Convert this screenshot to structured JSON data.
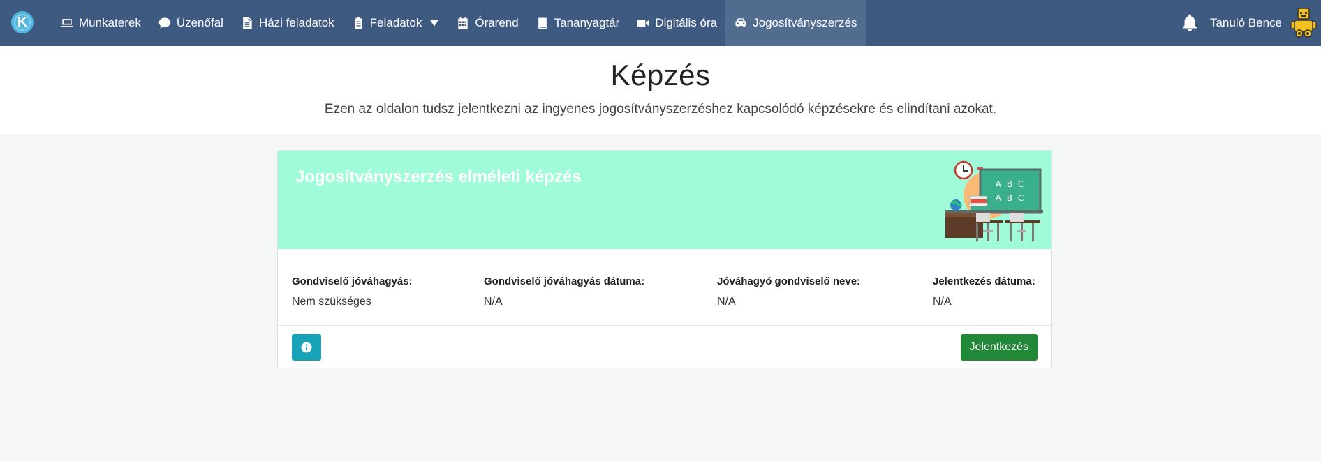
{
  "navbar": {
    "logo_letter": "K",
    "items": [
      {
        "label": "Munkaterek",
        "icon": "laptop-icon"
      },
      {
        "label": "Üzenőfal",
        "icon": "chat-bubble-icon"
      },
      {
        "label": "Házi feladatok",
        "icon": "document-icon"
      },
      {
        "label": "Feladatok",
        "icon": "clipboard-icon"
      },
      {
        "label": "Órarend",
        "icon": "calendar-icon"
      },
      {
        "label": "Tananyagtár",
        "icon": "book-icon"
      },
      {
        "label": "Digitális óra",
        "icon": "video-camera-icon"
      },
      {
        "label": "Jogosítványszerzés",
        "icon": "car-icon",
        "active": true
      }
    ],
    "user_name": "Tanuló Bence",
    "colors": {
      "background": "#3f5a80",
      "active": "#526c90"
    }
  },
  "header": {
    "title": "Képzés",
    "subtitle": "Ezen az oldalon tudsz jelentkezni az ingyenes jogosítványszerzéshez kapcsolódó képzésekre és elindítani azokat."
  },
  "card": {
    "title": "Jogosítványszerzés elméleti képzés",
    "banner_color": "#a0fcd8",
    "illustration": {
      "board_text_1": "A B C",
      "board_text_2": "A B C"
    },
    "fields": [
      {
        "label": "Gondviselő jóváhagyás:",
        "value": "Nem szükséges"
      },
      {
        "label": "Gondviselő jóváhagyás dátuma:",
        "value": "N/A"
      },
      {
        "label": "Jóváhagyó gondviselő neve:",
        "value": "N/A"
      },
      {
        "label": "Jelentkezés dátuma:",
        "value": "N/A"
      }
    ],
    "apply_label": "Jelentkezés",
    "colors": {
      "info_button": "#17a2b8",
      "apply_button": "#218838"
    }
  }
}
